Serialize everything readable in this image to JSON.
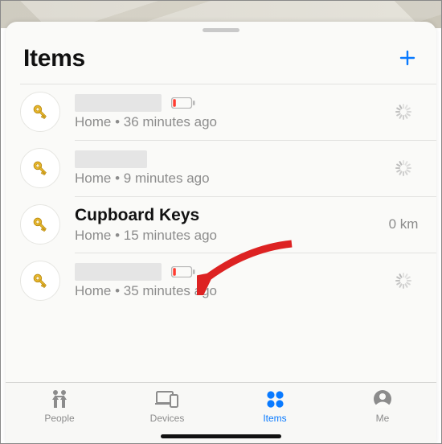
{
  "header": {
    "title": "Items"
  },
  "items": [
    {
      "name_redacted": true,
      "location": "Home",
      "sep": " • ",
      "ago": "36 minutes ago",
      "low_battery": true,
      "trailing": "spinner"
    },
    {
      "name_redacted": true,
      "location": "Home",
      "sep": " • ",
      "ago": "9 minutes ago",
      "low_battery": false,
      "trailing": "spinner"
    },
    {
      "name": "Cupboard Keys",
      "name_redacted": false,
      "location": "Home",
      "sep": " • ",
      "ago": "15 minutes ago",
      "low_battery": false,
      "trailing": "distance",
      "distance": "0 km"
    },
    {
      "name_redacted": true,
      "location": "Home",
      "sep": " • ",
      "ago": "35 minutes ago",
      "low_battery": true,
      "trailing": "spinner"
    }
  ],
  "tabs": {
    "people": "People",
    "devices": "Devices",
    "items": "Items",
    "me": "Me"
  },
  "colors": {
    "accent": "#097aff"
  }
}
